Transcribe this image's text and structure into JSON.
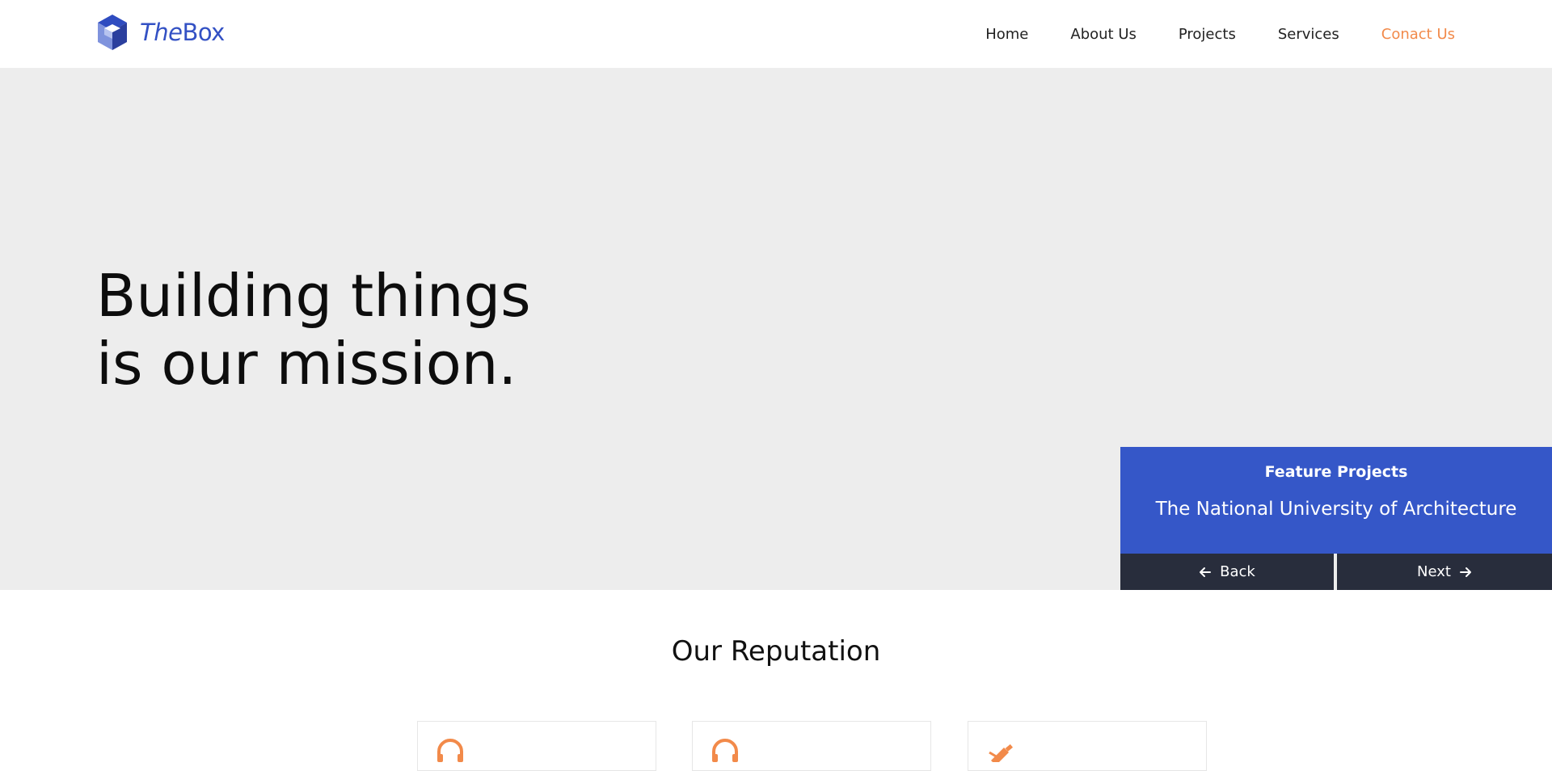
{
  "header": {
    "brand": {
      "prefix": "The",
      "name": "Box",
      "logo_icon": "cube-icon"
    },
    "nav": [
      {
        "label": "Home"
      },
      {
        "label": "About Us"
      },
      {
        "label": "Projects"
      },
      {
        "label": "Services"
      },
      {
        "label": "Conact Us",
        "accent": true
      }
    ]
  },
  "hero": {
    "headline_line1": "Building things",
    "headline_line2": "is our mission."
  },
  "feature": {
    "label": "Feature Projects",
    "title": "The National University of Architecture",
    "back_label": "Back",
    "next_label": "Next"
  },
  "reputation": {
    "title": "Our Reputation",
    "cards": [
      {
        "icon": "headset-icon"
      },
      {
        "icon": "headset-icon"
      },
      {
        "icon": "pencil-ruler-icon"
      }
    ]
  },
  "colors": {
    "brand_blue": "#3351c4",
    "feature_blue": "#3557c8",
    "accent_orange": "#f28a4a",
    "dark_button": "#282d3c",
    "hero_bg": "#ededed"
  }
}
